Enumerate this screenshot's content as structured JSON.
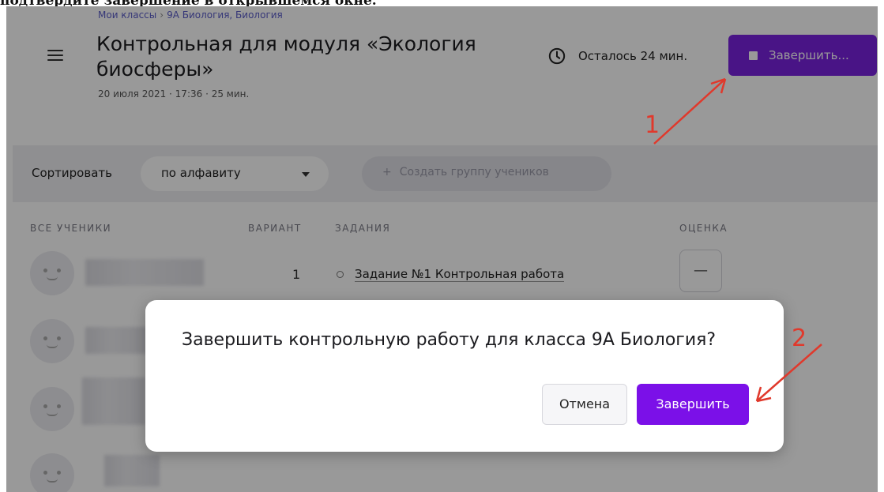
{
  "caption": "подтвердите завершение в открывшемся окне.",
  "header": {
    "breadcrumb": [
      "Мои классы",
      "9А Биология, Биология"
    ],
    "title": "Контрольная для модуля «Экология биосферы»",
    "meta": "20 июля 2021 · 17:36 · 25 мин.",
    "timer_text": "Осталось 24 мин.",
    "finish_button": "Завершить..."
  },
  "toolbar": {
    "sort_label": "Сортировать",
    "sort_value": "по алфавиту",
    "create_group": "Создать группу учеников"
  },
  "table": {
    "headers": [
      "ВСЕ УЧЕНИКИ",
      "ВАРИАНТ",
      "ЗАДАНИЯ",
      "ОЦЕНКА"
    ],
    "first_row": {
      "variant": "1",
      "task": "Задание №1 Контрольная работа",
      "grade": "—"
    }
  },
  "dialog": {
    "title": "Завершить контрольную работу для класса 9А Биология?",
    "cancel": "Отмена",
    "confirm": "Завершить"
  },
  "annotations": {
    "step1": "1",
    "step2": "2",
    "arrow_color": "#e0392c"
  },
  "colors": {
    "accent": "#7b22e0"
  }
}
